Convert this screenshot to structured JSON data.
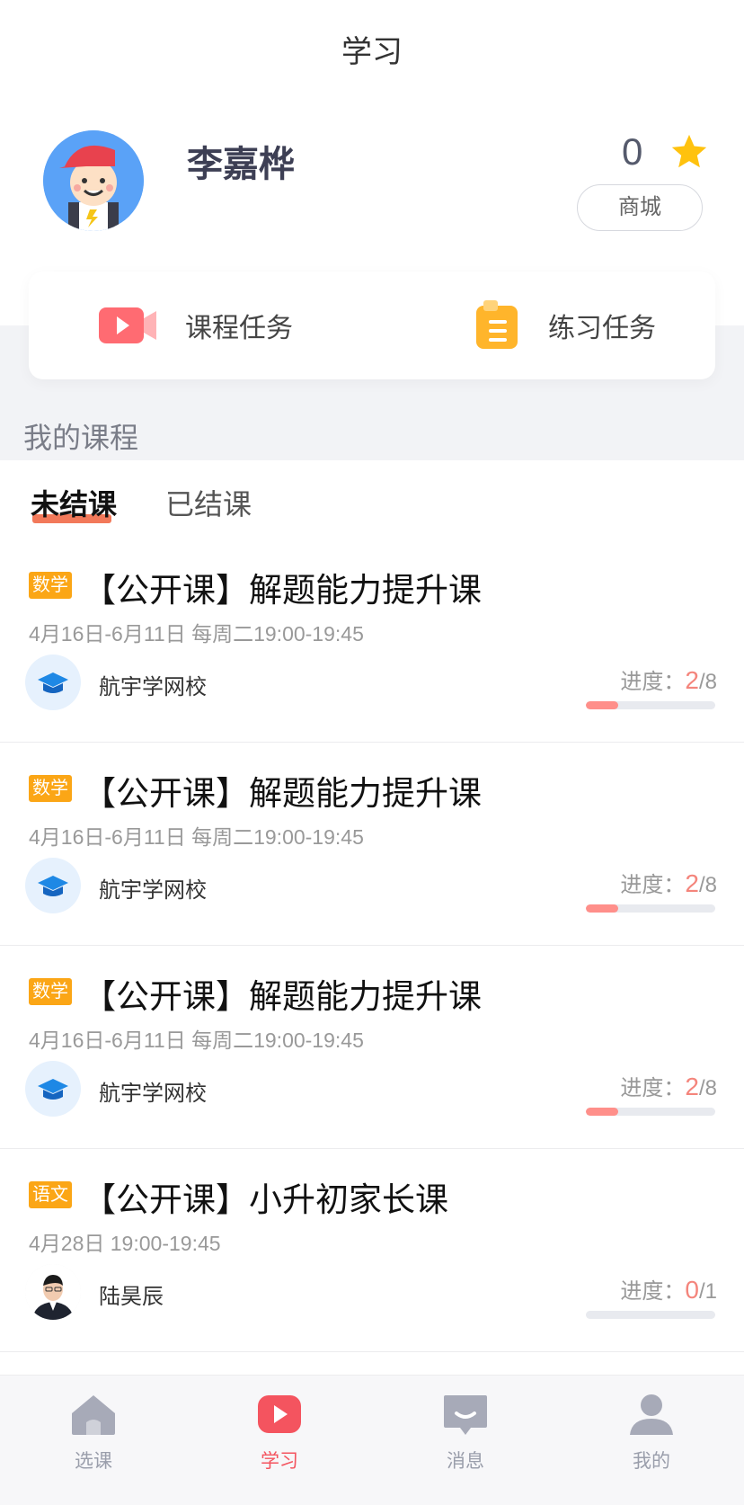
{
  "header": {
    "title": "学习"
  },
  "profile": {
    "name": "李嘉桦",
    "points": "0",
    "mall_label": "商城"
  },
  "tasks": {
    "course_task": "课程任务",
    "practice_task": "练习任务"
  },
  "section": {
    "my_courses": "我的课程"
  },
  "tabs": {
    "ongoing": "未结课",
    "finished": "已结课"
  },
  "progress_prefix": "进度：",
  "courses": [
    {
      "subject": "数学",
      "title": "【公开课】解题能力提升课",
      "time": "4月16日-6月11日 每周二19:00-19:45",
      "teacher": "航宇学网校",
      "progress_current": "2",
      "progress_total": "/8",
      "progress_fraction": 0.25,
      "avatar_icon": "graduation-cap-icon"
    },
    {
      "subject": "数学",
      "title": "【公开课】解题能力提升课",
      "time": "4月16日-6月11日 每周二19:00-19:45",
      "teacher": "航宇学网校",
      "progress_current": "2",
      "progress_total": "/8",
      "progress_fraction": 0.25,
      "avatar_icon": "graduation-cap-icon"
    },
    {
      "subject": "数学",
      "title": "【公开课】解题能力提升课",
      "time": "4月16日-6月11日 每周二19:00-19:45",
      "teacher": "航宇学网校",
      "progress_current": "2",
      "progress_total": "/8",
      "progress_fraction": 0.25,
      "avatar_icon": "graduation-cap-icon"
    },
    {
      "subject": "语文",
      "title": "【公开课】小升初家长课",
      "time": "4月28日 19:00-19:45",
      "teacher": "陆昊辰",
      "progress_current": "0",
      "progress_total": "/1",
      "progress_fraction": 0,
      "avatar_icon": "teacher-photo"
    }
  ],
  "tabbar": {
    "items": [
      {
        "label": "选课",
        "icon": "home-icon",
        "active": false
      },
      {
        "label": "学习",
        "icon": "play-icon",
        "active": true
      },
      {
        "label": "消息",
        "icon": "message-icon",
        "active": false
      },
      {
        "label": "我的",
        "icon": "user-icon",
        "active": false
      }
    ]
  },
  "colors": {
    "accent": "#f4545f",
    "subject_badge": "#fba616",
    "progress_fill": "#ff8f8a",
    "tab_underline": "#f2795a"
  }
}
